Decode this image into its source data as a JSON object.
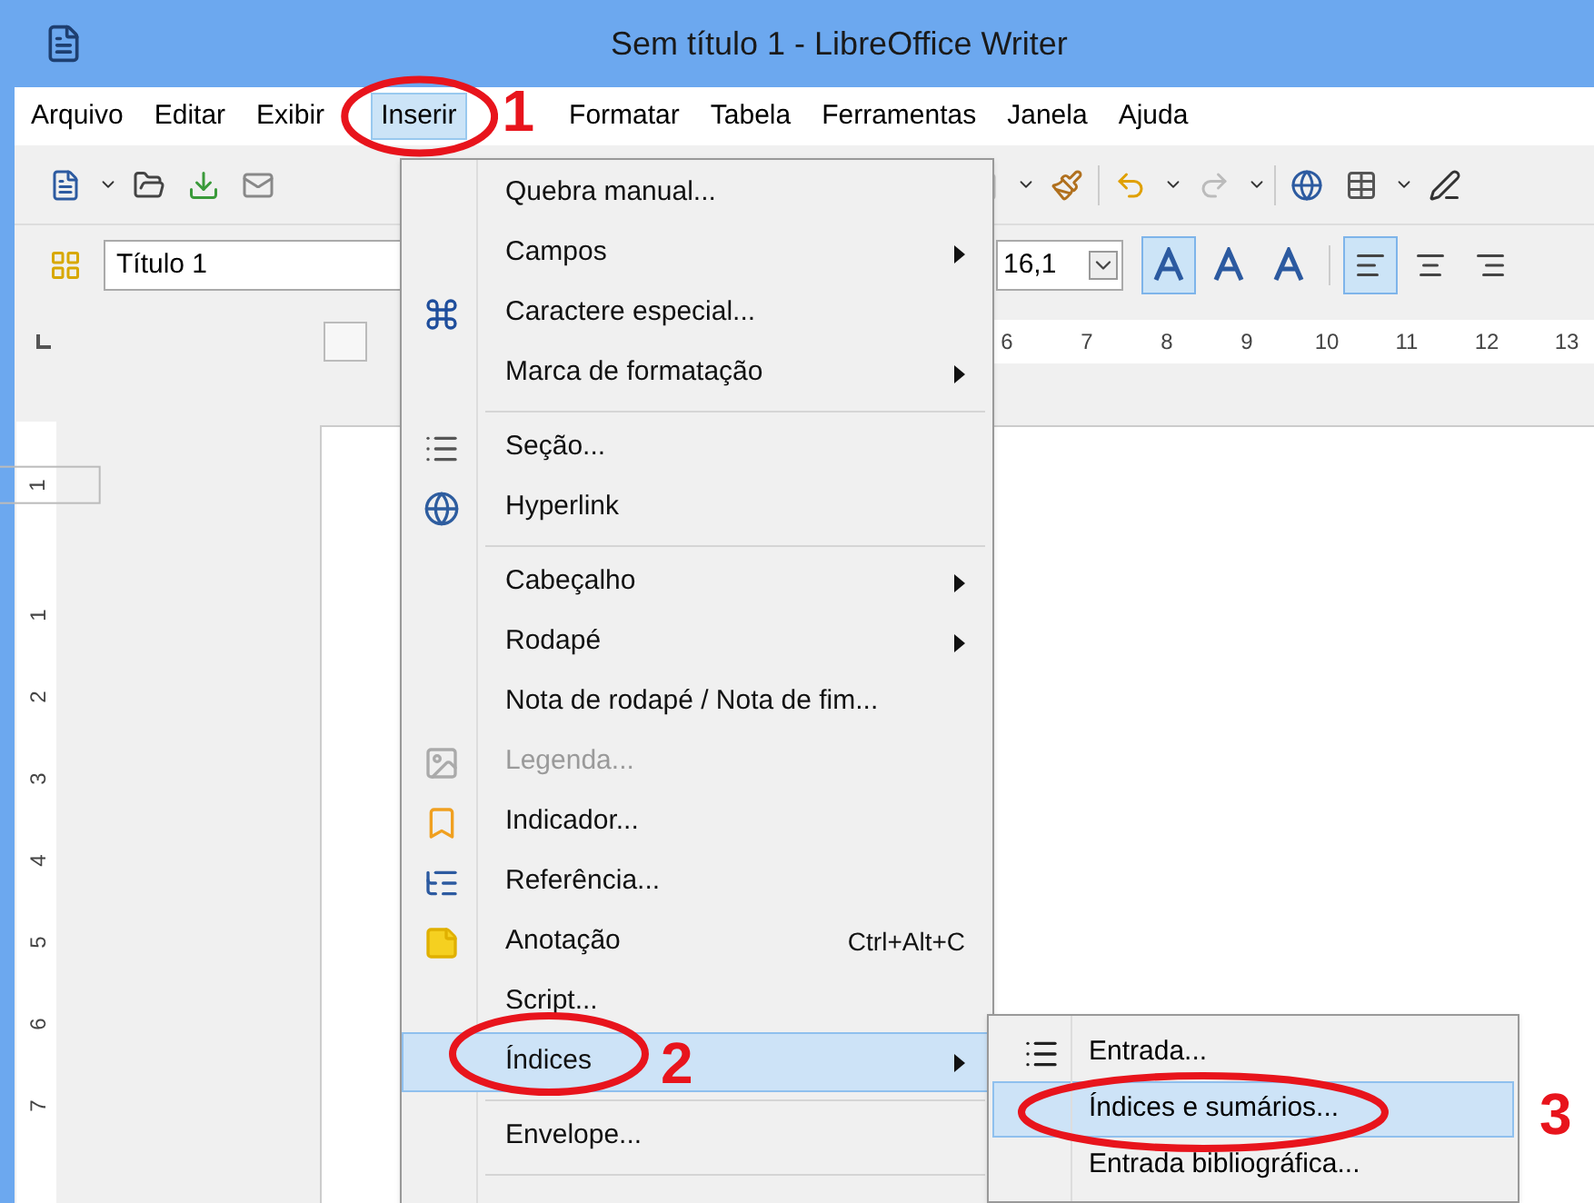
{
  "window": {
    "title": "Sem título 1 - LibreOffice Writer"
  },
  "menu_bar": [
    {
      "label": "Arquivo",
      "selected": false
    },
    {
      "label": "Editar",
      "selected": false
    },
    {
      "label": "Exibir",
      "selected": false
    },
    {
      "label": "Inserir",
      "selected": true
    },
    {
      "label": "Formatar",
      "selected": false
    },
    {
      "label": "Tabela",
      "selected": false
    },
    {
      "label": "Ferramentas",
      "selected": false
    },
    {
      "label": "Janela",
      "selected": false
    },
    {
      "label": "Ajuda",
      "selected": false
    }
  ],
  "style_box": {
    "value": "Título 1"
  },
  "font_size": {
    "value": "16,1"
  },
  "format_buttons": [
    {
      "selected": true
    },
    {
      "selected": false
    },
    {
      "selected": false
    }
  ],
  "align_buttons": [
    {
      "selected": true
    },
    {
      "selected": false
    },
    {
      "selected": false
    }
  ],
  "ruler": {
    "horizontal": [
      "6",
      "7",
      "8",
      "9",
      "10",
      "11",
      "12",
      "13"
    ],
    "vertical": [
      "1",
      "1",
      "2",
      "3",
      "4",
      "5",
      "6",
      "7"
    ]
  },
  "insert_menu": [
    {
      "kind": "item",
      "label": "Quebra manual...",
      "selected": false,
      "disabled": false,
      "has_submenu": false
    },
    {
      "kind": "item",
      "label": "Campos",
      "selected": false,
      "disabled": false,
      "has_submenu": true
    },
    {
      "kind": "item",
      "label": "Caractere especial...",
      "selected": false,
      "disabled": false,
      "has_submenu": false
    },
    {
      "kind": "item",
      "label": "Marca de formatação",
      "selected": false,
      "disabled": false,
      "has_submenu": true
    },
    {
      "kind": "separator"
    },
    {
      "kind": "item",
      "label": "Seção...",
      "selected": false,
      "disabled": false,
      "has_submenu": false
    },
    {
      "kind": "item",
      "label": "Hyperlink",
      "selected": false,
      "disabled": false,
      "has_submenu": false
    },
    {
      "kind": "separator"
    },
    {
      "kind": "item",
      "label": "Cabeçalho",
      "selected": false,
      "disabled": false,
      "has_submenu": true
    },
    {
      "kind": "item",
      "label": "Rodapé",
      "selected": false,
      "disabled": false,
      "has_submenu": true
    },
    {
      "kind": "item",
      "label": "Nota de rodapé / Nota de fim...",
      "selected": false,
      "disabled": false,
      "has_submenu": false
    },
    {
      "kind": "item",
      "label": "Legenda...",
      "selected": false,
      "disabled": true,
      "has_submenu": false
    },
    {
      "kind": "item",
      "label": "Indicador...",
      "selected": false,
      "disabled": false,
      "has_submenu": false
    },
    {
      "kind": "item",
      "label": "Referência...",
      "selected": false,
      "disabled": false,
      "has_submenu": false
    },
    {
      "kind": "item",
      "label": "Anotação",
      "shortcut": "Ctrl+Alt+C",
      "selected": false,
      "disabled": false,
      "has_submenu": false
    },
    {
      "kind": "item",
      "label": "Script...",
      "selected": false,
      "disabled": false,
      "has_submenu": false
    },
    {
      "kind": "item",
      "label": "Índices",
      "selected": true,
      "disabled": false,
      "has_submenu": true
    },
    {
      "kind": "separator"
    },
    {
      "kind": "item",
      "label": "Envelope...",
      "selected": false,
      "disabled": false,
      "has_submenu": false
    },
    {
      "kind": "separator"
    }
  ],
  "indices_submenu": [
    {
      "label": "Entrada...",
      "selected": false
    },
    {
      "label": "Índices e sumários...",
      "selected": true
    },
    {
      "label": "Entrada bibliográfica...",
      "selected": false
    }
  ],
  "annotations": [
    {
      "label": "1"
    },
    {
      "label": "2"
    },
    {
      "label": "3"
    }
  ]
}
